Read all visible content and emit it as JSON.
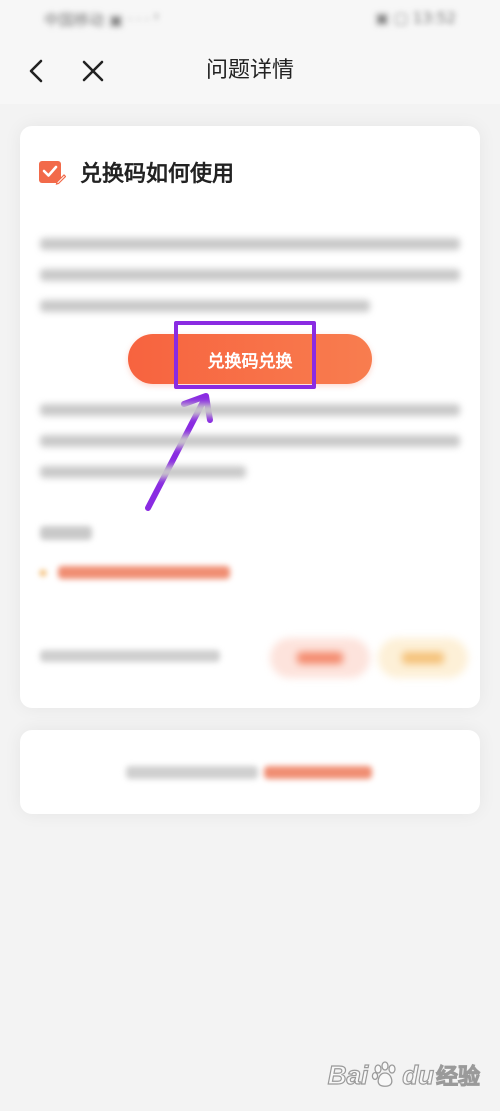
{
  "status_bar": {
    "time": "中国移动 ▣ ᐧ ᐧ ᐧ ꜛ",
    "right": "▣ ▢ 13:52"
  },
  "nav": {
    "title": "问题详情",
    "back_icon": "chevron-left-icon",
    "close_icon": "close-icon"
  },
  "card": {
    "title": "兑换码如何使用",
    "title_icon": "checked-edit-icon",
    "button_label": "兑换码兑换",
    "button_color": "#f7633f",
    "highlight_color": "#8a2be2"
  },
  "watermark": {
    "part_a": "Bai",
    "part_b": "du",
    "part_c": "经验"
  }
}
